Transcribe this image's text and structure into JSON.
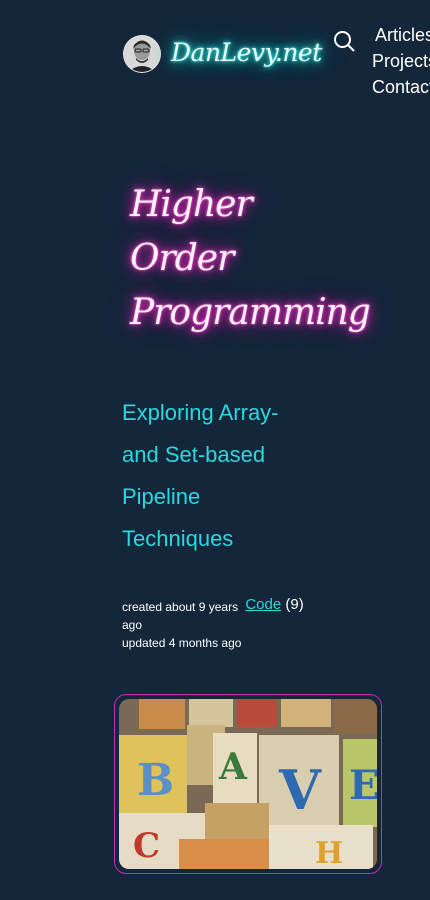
{
  "header": {
    "site_title": "DanLevy.net",
    "avatar_icon": "avatar-photo",
    "search_icon": "search-icon",
    "nav": [
      {
        "label": "Articles"
      },
      {
        "label": "Projects"
      },
      {
        "label": "Contact"
      }
    ]
  },
  "post": {
    "title_lines": [
      "Higher",
      "Order",
      "Programming"
    ],
    "subtitle": "Exploring Array- and Set-based Pipeline Techniques",
    "created": "created about 9 years ago",
    "tag": "Code",
    "tag_count": "(9)",
    "updated": "updated 4 months ago",
    "hero_image": "alphabet-blocks-photo"
  },
  "colors": {
    "background": "#13263a",
    "accent_cyan": "#2dd7e0",
    "accent_magenta": "#e62fbd"
  }
}
